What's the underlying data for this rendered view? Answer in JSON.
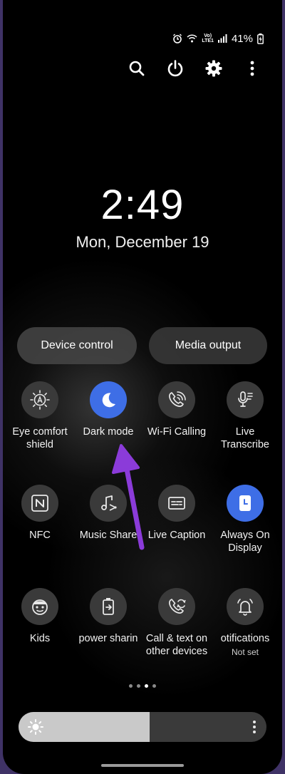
{
  "status_bar": {
    "battery_percent": "41%",
    "network_label_top": "Vo)",
    "network_label_bottom": "LTE1"
  },
  "clock": {
    "time": "2:49",
    "date": "Mon, December 19"
  },
  "buttons": {
    "device_control": "Device control",
    "media_output": "Media output"
  },
  "tiles": [
    {
      "label_1": "Eye comfort",
      "label_2": "shield",
      "icon": "eye-comfort-icon",
      "on": false
    },
    {
      "label_1": "Dark mode",
      "label_2": "",
      "icon": "moon-icon",
      "on": true
    },
    {
      "label_1": "Wi-Fi Calling",
      "label_2": "",
      "icon": "wifi-calling-icon",
      "on": false
    },
    {
      "label_1": "Live",
      "label_2": "Transcribe",
      "icon": "live-transcribe-icon",
      "on": false
    },
    {
      "label_1": "NFC",
      "label_2": "",
      "icon": "nfc-icon",
      "on": false
    },
    {
      "label_1": "Music Share",
      "label_2": "",
      "icon": "music-share-icon",
      "on": false
    },
    {
      "label_1": "Live Caption",
      "label_2": "",
      "icon": "live-caption-icon",
      "on": false
    },
    {
      "label_1": "Always On",
      "label_2": "Display",
      "icon": "clock-icon",
      "on": true
    },
    {
      "label_1": "Kids",
      "label_2": "",
      "icon": "kids-icon",
      "on": false
    },
    {
      "label_1": "power sharin",
      "label_2": "",
      "icon": "power-sharing-icon",
      "on": false
    },
    {
      "label_1": "Call & text on",
      "label_2": "other devices",
      "icon": "call-text-icon",
      "on": false
    },
    {
      "label_1": "otifications",
      "label_2": "",
      "sub": "Not set",
      "icon": "notifications-icon",
      "on": false
    }
  ],
  "pager": {
    "page_count": 4,
    "active_index": 2
  },
  "brightness": {
    "level": 0.53
  },
  "colors": {
    "accent": "#3e6ee6",
    "annotation_arrow": "#8b3bd9",
    "background": "#000000"
  }
}
